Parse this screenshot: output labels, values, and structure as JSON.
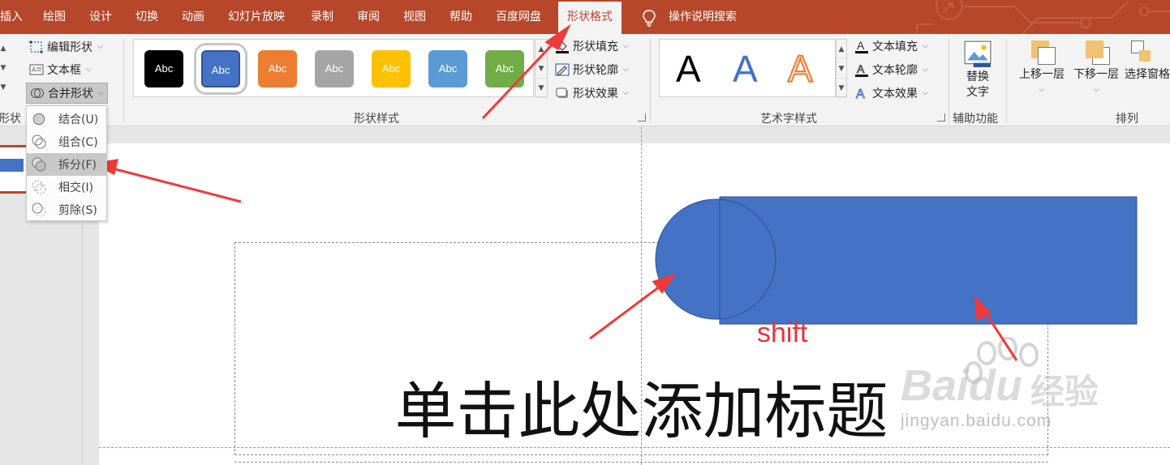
{
  "tabs": [
    {
      "label": "插入"
    },
    {
      "label": "绘图"
    },
    {
      "label": "设计"
    },
    {
      "label": "切换"
    },
    {
      "label": "动画"
    },
    {
      "label": "幻灯片放映"
    },
    {
      "label": "录制"
    },
    {
      "label": "审阅"
    },
    {
      "label": "视图"
    },
    {
      "label": "帮助"
    },
    {
      "label": "百度网盘"
    },
    {
      "label": "形状格式",
      "active": true
    }
  ],
  "search": {
    "label": "操作说明搜索",
    "icon": "lightbulb-icon"
  },
  "ribbon": {
    "insert_shapes": {
      "edit_shape": "编辑形状",
      "text_box": "文本框",
      "merge_shapes": "合并形状",
      "group_label": "形状"
    },
    "shape_styles": {
      "swatches": [
        {
          "text": "Abc",
          "color": "#000000"
        },
        {
          "text": "Abc",
          "color": "#4472c4",
          "selected": true
        },
        {
          "text": "Abc",
          "color": "#ed7d31"
        },
        {
          "text": "Abc",
          "color": "#a5a5a5"
        },
        {
          "text": "Abc",
          "color": "#ffc000"
        },
        {
          "text": "Abc",
          "color": "#5b9bd5"
        },
        {
          "text": "Abc",
          "color": "#70ad47"
        }
      ],
      "fill": "形状填充",
      "outline": "形状轮廓",
      "effects": "形状效果",
      "group_label": "形状样式"
    },
    "wordart": {
      "samples": [
        {
          "text": "A",
          "style": "black"
        },
        {
          "text": "A",
          "style": "blue"
        },
        {
          "text": "A",
          "style": "orange-outline"
        }
      ],
      "text_fill": "文本填充",
      "text_outline": "文本轮廓",
      "text_effects": "文本效果",
      "group_label": "艺术字样式"
    },
    "accessibility": {
      "alt_text_line1": "替换",
      "alt_text_line2": "文字",
      "group_label": "辅助功能"
    },
    "arrange": {
      "bring_forward": "上移一层",
      "send_backward": "下移一层",
      "selection_pane": "选择窗格",
      "group_label": "排列"
    }
  },
  "merge_menu": [
    {
      "label": "结合(U)",
      "icon": "union-icon"
    },
    {
      "label": "组合(C)",
      "icon": "combine-icon"
    },
    {
      "label": "拆分(F)",
      "icon": "fragment-icon",
      "highlighted": true
    },
    {
      "label": "相交(I)",
      "icon": "intersect-icon"
    },
    {
      "label": "剪除(S)",
      "icon": "subtract-icon"
    }
  ],
  "slide": {
    "title_placeholder": "单击此处添加标题",
    "annotation": "shift",
    "shape_color": "#4472c4",
    "annotation_color": "#e8323c"
  },
  "watermark": {
    "brand": "Bai",
    "brand2": "du",
    "cn": "经验",
    "url": "jingyan.baidu.com"
  },
  "colors": {
    "accent": "#b7472a",
    "ribbon_bg": "#f3f3f3",
    "arrow": "#f03a3a"
  }
}
